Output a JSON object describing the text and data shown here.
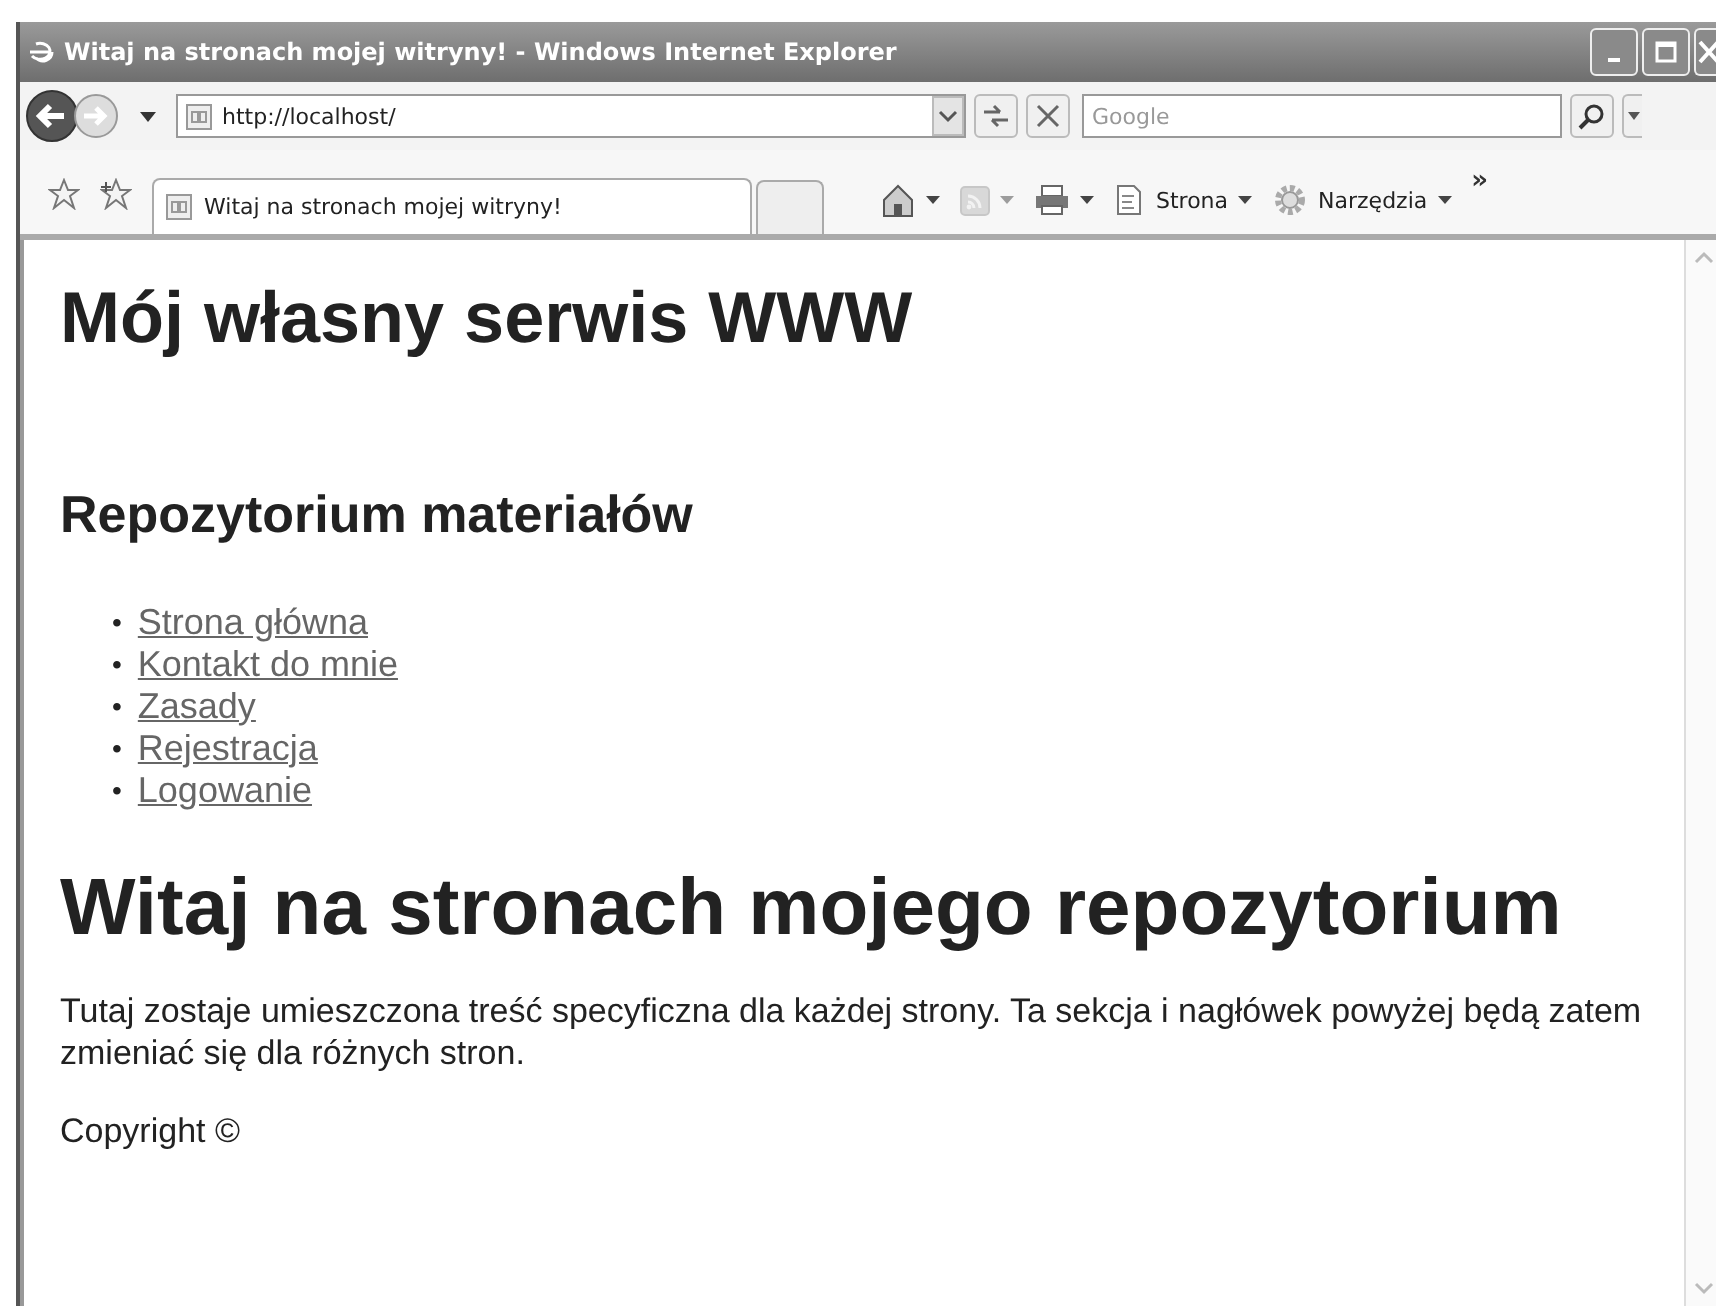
{
  "window": {
    "title": "Witaj na stronach mojej witryny! - Windows Internet Explorer"
  },
  "address_bar": {
    "value": "http://localhost/"
  },
  "search": {
    "placeholder": "Google"
  },
  "tabs": [
    {
      "label": "Witaj na stronach mojej witryny!",
      "selected": true
    }
  ],
  "command_bar": {
    "items": [
      {
        "kind": "home",
        "disabled": false
      },
      {
        "kind": "feeds",
        "disabled": true
      },
      {
        "kind": "print",
        "disabled": false
      },
      {
        "kind": "page",
        "label": "Strona",
        "disabled": false
      },
      {
        "kind": "tools",
        "label": "Narzędzia",
        "disabled": false
      }
    ],
    "overflow": "»"
  },
  "page": {
    "site_title": "Mój własny serwis WWW",
    "nav_heading": "Repozytorium materiałów",
    "nav_links": [
      {
        "bullet": "•",
        "label": "Strona główna"
      },
      {
        "bullet": "•",
        "label": "Kontakt do mnie"
      },
      {
        "bullet": "•",
        "label": "Zasady"
      },
      {
        "bullet": "•",
        "label": "Rejestracja"
      },
      {
        "bullet": "•",
        "label": "Logowanie"
      }
    ],
    "heading": "Witaj na stronach mojego repozytorium",
    "paragraph": "Tutaj zostaje umieszczona treść specyficzna dla każdej strony. Ta sekcja i nagłówek powyżej będą zatem zmieniać się dla różnych stron.",
    "footer": "Copyright ©"
  }
}
